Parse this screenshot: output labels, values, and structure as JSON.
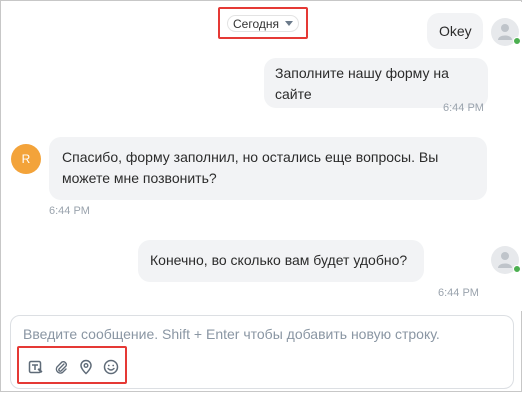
{
  "date_selector": {
    "label": "Сегодня"
  },
  "messages": [
    {
      "side": "right",
      "text": "Okey",
      "time": ""
    },
    {
      "side": "right",
      "lines": [
        "Заполните нашу форму на",
        "сайте"
      ],
      "time": "6:44 PM"
    },
    {
      "side": "left",
      "avatar": "R",
      "lines": [
        "Спасибо, форму заполнил, но остались еще вопросы. Вы",
        "можете мне позвонить?"
      ],
      "time": "6:44 PM"
    },
    {
      "side": "right",
      "text": "Конечно, во сколько вам будет удобно?",
      "time": "6:44 PM"
    }
  ],
  "composer": {
    "placeholder": "Введите сообщение. Shift + Enter чтобы добавить новую строку.",
    "tools": [
      "template-icon",
      "attach-icon",
      "location-icon",
      "emoji-icon"
    ]
  },
  "colors": {
    "highlight": "#e53935",
    "bubble": "#f2f3f5",
    "avatar_r": "#f3a33a",
    "online": "#4caf50"
  }
}
